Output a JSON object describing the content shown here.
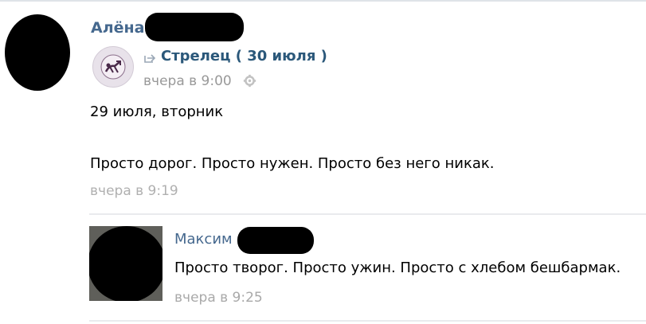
{
  "post": {
    "author": "Алёна",
    "repost": {
      "source_title": "Стрелец ( 30 июля )",
      "time": "вчера в 9:00",
      "avatar_icon": "sagittarius-zodiac-icon"
    },
    "text_line1": "29 июля, вторник",
    "text_line2": "Просто дорог. Просто нужен. Просто без него никак.",
    "time": "вчера в 9:19"
  },
  "comment": {
    "author": "Максим",
    "text": "Просто творог. Просто ужин. Просто с хлебом бешбармак.",
    "time": "вчера в 9:25"
  },
  "colors": {
    "link": "#45688e",
    "muted": "#999999",
    "divider": "#e9ebee"
  }
}
